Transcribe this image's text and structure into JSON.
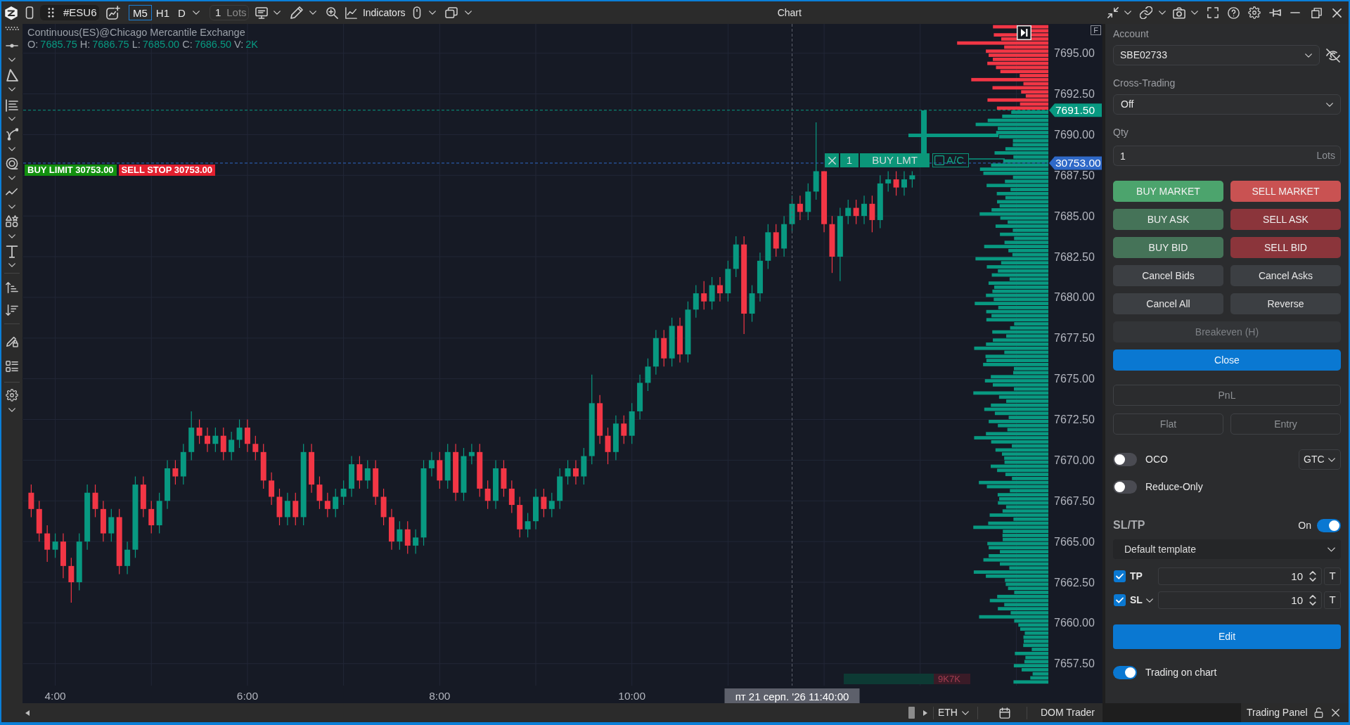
{
  "window": {
    "title": "Chart"
  },
  "toolbar": {
    "symbol": "#ESU6",
    "timeframes": [
      {
        "label": "M5",
        "selected": true
      },
      {
        "label": "H1",
        "selected": false
      },
      {
        "label": "D",
        "selected": false
      }
    ],
    "quantity": {
      "value": "1",
      "unit": "Lots"
    },
    "indicators": "Indicators"
  },
  "chart": {
    "legend": {
      "title": "Continuous(ES)@Chicago Mercantile Exchange",
      "values": [
        {
          "key": "O:",
          "value": "7685.75"
        },
        {
          "key": "H:",
          "value": "7686.75"
        },
        {
          "key": "L:",
          "value": "7685.00"
        },
        {
          "key": "C:",
          "value": "7686.50"
        },
        {
          "key": "V:",
          "value": "2K"
        }
      ]
    },
    "chart_data": [
      {
        "type": "candlestick",
        "x": [
          "2026-08-21T03:45",
          "2026-08-21T03:50",
          "2026-08-21T03:55",
          "2026-08-21T04:00",
          "2026-08-21T04:05",
          "2026-08-21T04:10",
          "2026-08-21T04:15",
          "2026-08-21T04:20",
          "2026-08-21T04:25",
          "2026-08-21T04:30",
          "2026-08-21T04:35",
          "2026-08-21T04:40",
          "2026-08-21T04:45",
          "2026-08-21T04:50",
          "2026-08-21T04:55",
          "2026-08-21T05:00",
          "2026-08-21T05:05",
          "2026-08-21T05:10",
          "2026-08-21T05:15",
          "2026-08-21T05:20",
          "2026-08-21T05:25",
          "2026-08-21T05:30",
          "2026-08-21T05:35",
          "2026-08-21T05:40",
          "2026-08-21T05:45",
          "2026-08-21T05:50",
          "2026-08-21T05:55",
          "2026-08-21T06:00",
          "2026-08-21T06:05",
          "2026-08-21T06:10",
          "2026-08-21T06:15",
          "2026-08-21T06:20",
          "2026-08-21T06:25",
          "2026-08-21T06:30",
          "2026-08-21T06:35",
          "2026-08-21T06:40",
          "2026-08-21T06:45",
          "2026-08-21T06:50",
          "2026-08-21T06:55",
          "2026-08-21T07:00",
          "2026-08-21T07:05",
          "2026-08-21T07:10",
          "2026-08-21T07:15",
          "2026-08-21T07:20",
          "2026-08-21T07:25",
          "2026-08-21T07:30",
          "2026-08-21T07:35",
          "2026-08-21T07:40",
          "2026-08-21T07:45",
          "2026-08-21T07:50",
          "2026-08-21T07:55",
          "2026-08-21T08:00",
          "2026-08-21T08:05",
          "2026-08-21T08:10",
          "2026-08-21T08:15",
          "2026-08-21T08:20",
          "2026-08-21T08:25",
          "2026-08-21T08:30",
          "2026-08-21T08:35",
          "2026-08-21T08:40",
          "2026-08-21T08:45",
          "2026-08-21T08:50",
          "2026-08-21T08:55",
          "2026-08-21T09:00",
          "2026-08-21T09:05",
          "2026-08-21T09:10",
          "2026-08-21T09:15",
          "2026-08-21T09:20",
          "2026-08-21T09:25",
          "2026-08-21T09:30",
          "2026-08-21T09:35",
          "2026-08-21T09:40",
          "2026-08-21T09:45",
          "2026-08-21T09:50",
          "2026-08-21T09:55",
          "2026-08-21T10:00",
          "2026-08-21T10:05",
          "2026-08-21T10:10",
          "2026-08-21T10:15",
          "2026-08-21T10:20",
          "2026-08-21T10:25",
          "2026-08-21T10:30",
          "2026-08-21T10:35",
          "2026-08-21T10:40",
          "2026-08-21T10:45",
          "2026-08-21T10:50",
          "2026-08-21T10:55",
          "2026-08-21T11:00",
          "2026-08-21T11:05",
          "2026-08-21T11:10",
          "2026-08-21T11:15",
          "2026-08-21T11:20",
          "2026-08-21T11:25",
          "2026-08-21T11:30",
          "2026-08-21T11:35",
          "2026-08-21T11:40",
          "2026-08-21T11:45",
          "2026-08-21T11:50",
          "2026-08-21T11:55",
          "2026-08-21T12:00",
          "2026-08-21T12:05",
          "2026-08-21T12:10",
          "2026-08-21T12:15",
          "2026-08-21T12:20",
          "2026-08-21T12:25",
          "2026-08-21T12:30",
          "2026-08-21T12:35",
          "2026-08-21T12:40",
          "2026-08-21T12:45",
          "2026-08-21T12:50",
          "2026-08-21T12:55"
        ],
        "ohlc": [
          [
            7668,
            7668.5,
            7666.5,
            7667
          ],
          [
            7667,
            7667.5,
            7665,
            7665.5
          ],
          [
            7665.5,
            7666,
            7663.75,
            7664.5
          ],
          [
            7664.5,
            7665.5,
            7664,
            7665
          ],
          [
            7665,
            7665.5,
            7662.75,
            7663.5
          ],
          [
            7663.5,
            7664,
            7661.25,
            7662.5
          ],
          [
            7662.5,
            7665.5,
            7662,
            7665
          ],
          [
            7665,
            7668.5,
            7664.5,
            7668
          ],
          [
            7668,
            7668.5,
            7666.5,
            7667
          ],
          [
            7667,
            7667.5,
            7665,
            7665.5
          ],
          [
            7665.5,
            7667,
            7665,
            7666.5
          ],
          [
            7666.5,
            7667,
            7663,
            7663.5
          ],
          [
            7663.5,
            7665,
            7663,
            7664.5
          ],
          [
            7664.5,
            7669,
            7664,
            7668.5
          ],
          [
            7668.5,
            7669,
            7666.5,
            7667
          ],
          [
            7667,
            7667.5,
            7665.5,
            7666
          ],
          [
            7666,
            7668,
            7665.5,
            7667.5
          ],
          [
            7667.5,
            7670,
            7667,
            7669.5
          ],
          [
            7669.5,
            7670,
            7668.5,
            7669
          ],
          [
            7669,
            7671,
            7668.5,
            7670.5
          ],
          [
            7670.5,
            7673,
            7670,
            7672
          ],
          [
            7672,
            7672.5,
            7671,
            7671.5
          ],
          [
            7671.5,
            7672,
            7670.5,
            7671
          ],
          [
            7671,
            7672,
            7670.5,
            7671.5
          ],
          [
            7671.5,
            7672,
            7670,
            7670.5
          ],
          [
            7670.5,
            7671.75,
            7670,
            7671.25
          ],
          [
            7671.25,
            7672.5,
            7670.75,
            7672
          ],
          [
            7672,
            7672.5,
            7670.5,
            7671
          ],
          [
            7671,
            7671.5,
            7670,
            7670.5
          ],
          [
            7670.5,
            7671,
            7668.25,
            7668.75
          ],
          [
            7668.75,
            7669.25,
            7667.25,
            7667.75
          ],
          [
            7667.75,
            7668.25,
            7666,
            7666.5
          ],
          [
            7666.5,
            7668,
            7666,
            7667.5
          ],
          [
            7667.5,
            7668,
            7666,
            7666.5
          ],
          [
            7666.5,
            7671,
            7666,
            7670.5
          ],
          [
            7670.5,
            7671,
            7668,
            7668.5
          ],
          [
            7668.5,
            7669,
            7667,
            7667.5
          ],
          [
            7667.5,
            7668,
            7666.5,
            7667
          ],
          [
            7667,
            7668.25,
            7666.5,
            7667.75
          ],
          [
            7667.75,
            7668.75,
            7667.25,
            7668.25
          ],
          [
            7668.25,
            7670.25,
            7667.75,
            7669.75
          ],
          [
            7669.75,
            7670.25,
            7668.25,
            7668.75
          ],
          [
            7668.75,
            7670,
            7668.25,
            7669.5
          ],
          [
            7669.5,
            7670,
            7667.25,
            7667.75
          ],
          [
            7667.75,
            7668.25,
            7666,
            7666.5
          ],
          [
            7666.5,
            7667,
            7664.5,
            7665
          ],
          [
            7665,
            7666.25,
            7664.5,
            7665.75
          ],
          [
            7665.75,
            7666.25,
            7664.25,
            7664.75
          ],
          [
            7664.75,
            7665.75,
            7664.25,
            7665.25
          ],
          [
            7665.25,
            7670,
            7664.75,
            7669.5
          ],
          [
            7669.5,
            7670.5,
            7669,
            7670
          ],
          [
            7670,
            7670.5,
            7668.25,
            7668.75
          ],
          [
            7668.75,
            7671,
            7668.25,
            7670.5
          ],
          [
            7670.5,
            7671,
            7667.5,
            7668
          ],
          [
            7668,
            7670.75,
            7667.5,
            7670.25
          ],
          [
            7670.25,
            7671,
            7669.75,
            7670.5
          ],
          [
            7670.5,
            7671,
            7667.75,
            7668.25
          ],
          [
            7668.25,
            7668.75,
            7667,
            7667.5
          ],
          [
            7667.5,
            7670,
            7667,
            7669.5
          ],
          [
            7669.5,
            7670,
            7667.75,
            7668.25
          ],
          [
            7668.25,
            7668.75,
            7666.75,
            7667.25
          ],
          [
            7667.25,
            7667.75,
            7665.25,
            7665.75
          ],
          [
            7665.75,
            7666.75,
            7665.25,
            7666.25
          ],
          [
            7666.25,
            7668.25,
            7665.75,
            7667.75
          ],
          [
            7667.75,
            7668.25,
            7666.5,
            7667
          ],
          [
            7667,
            7668,
            7666.5,
            7667.5
          ],
          [
            7667.5,
            7669.5,
            7667,
            7669
          ],
          [
            7669,
            7670,
            7668.5,
            7669.5
          ],
          [
            7669.5,
            7670,
            7668.5,
            7669
          ],
          [
            7669,
            7670.75,
            7668.5,
            7670.25
          ],
          [
            7670.25,
            7675.25,
            7669.75,
            7673.5
          ],
          [
            7673.5,
            7674,
            7671,
            7671.5
          ],
          [
            7671.5,
            7672,
            7669.75,
            7670.5
          ],
          [
            7670.5,
            7672.75,
            7670,
            7672.25
          ],
          [
            7672.25,
            7672.75,
            7671,
            7671.5
          ],
          [
            7671.5,
            7673.5,
            7671,
            7673
          ],
          [
            7673,
            7675.25,
            7672.5,
            7674.75
          ],
          [
            7674.75,
            7676.25,
            7674.25,
            7675.75
          ],
          [
            7675.75,
            7678,
            7675.25,
            7677.5
          ],
          [
            7677.5,
            7678,
            7675.75,
            7676.25
          ],
          [
            7676.25,
            7678.75,
            7675.75,
            7678.25
          ],
          [
            7678.25,
            7678.75,
            7676,
            7676.5
          ],
          [
            7676.5,
            7679.75,
            7676,
            7679.25
          ],
          [
            7679.25,
            7680.75,
            7678.75,
            7680.25
          ],
          [
            7680.25,
            7681,
            7679.25,
            7679.75
          ],
          [
            7679.75,
            7681.25,
            7679.25,
            7680.75
          ],
          [
            7680.75,
            7681.25,
            7679.75,
            7680.25
          ],
          [
            7680.25,
            7682.25,
            7679.75,
            7681.75
          ],
          [
            7681.75,
            7683.75,
            7681.25,
            7683.25
          ],
          [
            7683.25,
            7683.75,
            7677.75,
            7679
          ],
          [
            7679,
            7680.75,
            7678.5,
            7680.25
          ],
          [
            7680.25,
            7682.75,
            7679.75,
            7682.25
          ],
          [
            7682.25,
            7684.5,
            7681.75,
            7684
          ],
          [
            7684,
            7684.5,
            7682.5,
            7683
          ],
          [
            7683,
            7685,
            7682.5,
            7684.5
          ],
          [
            7684.5,
            7686.25,
            7684,
            7685.75
          ],
          [
            7685.75,
            7686.25,
            7684.75,
            7685.25
          ],
          [
            7685.25,
            7687,
            7684.75,
            7686.5
          ],
          [
            7686.5,
            7690.75,
            7686,
            7687.75
          ],
          [
            7687.75,
            7687.75,
            7684,
            7684.5
          ],
          [
            7684.5,
            7685,
            7681.5,
            7682.5
          ],
          [
            7682.5,
            7685.5,
            7681,
            7685
          ],
          [
            7685,
            7686,
            7684.5,
            7685.5
          ],
          [
            7685.5,
            7686,
            7684.5,
            7685
          ],
          [
            7685,
            7686.25,
            7684.5,
            7685.75
          ],
          [
            7685.75,
            7686.25,
            7684,
            7684.75
          ],
          [
            7684.75,
            7687.5,
            7684.25,
            7687
          ],
          [
            7687,
            7687.75,
            7686.5,
            7687.25
          ],
          [
            7687.25,
            7687.75,
            7686.25,
            7686.75
          ],
          [
            7686.75,
            7687.75,
            7686.25,
            7687.25
          ],
          [
            7687.25,
            7687.75,
            7686.75,
            7687.5
          ]
        ],
        "xlim": [
          "2026-08-21T03:40",
          "2026-08-21T14:20"
        ],
        "ylim": [
          7656.15,
          7696.8
        ],
        "xticks": [
          {
            "value": "2026-08-21T04:00",
            "label": "4:00"
          },
          {
            "value": "2026-08-21T06:00",
            "label": "6:00"
          },
          {
            "value": "2026-08-21T08:00",
            "label": "8:00"
          },
          {
            "value": "2026-08-21T10:00",
            "label": "10:00"
          }
        ],
        "yticks": [
          {
            "value": 7695,
            "label": "7695.00"
          },
          {
            "value": 7692.5,
            "label": "7692.50"
          },
          {
            "value": 7690,
            "label": "7690.00"
          },
          {
            "value": 7687.5,
            "label": "7687.50"
          },
          {
            "value": 7685,
            "label": "7685.00"
          },
          {
            "value": 7682.5,
            "label": "7682.50"
          },
          {
            "value": 7680,
            "label": "7680.00"
          },
          {
            "value": 7677.5,
            "label": "7677.50"
          },
          {
            "value": 7675,
            "label": "7675.00"
          },
          {
            "value": 7672.5,
            "label": "7672.50"
          },
          {
            "value": 7670,
            "label": "7670.00"
          },
          {
            "value": 7667.5,
            "label": "7667.50"
          },
          {
            "value": 7665,
            "label": "7665.00"
          },
          {
            "value": 7662.5,
            "label": "7662.50"
          },
          {
            "value": 7660,
            "label": "7660.00"
          },
          {
            "value": 7657.5,
            "label": "7657.50"
          }
        ],
        "ref_lines": [
          {
            "axis": "y",
            "value": 7691.5,
            "label": "7691.50",
            "color": "#089981",
            "line_style": "dashed"
          },
          {
            "axis": "y",
            "value": 7688.25,
            "color": "#2f69c8",
            "line_style": "dashed"
          },
          {
            "axis": "x",
            "value": "2026-08-21T11:40",
            "label": "пт 21 серп. '26 11:40:00",
            "color": "#5d606b",
            "line_style": "dashed"
          }
        ],
        "grid": true
      }
    ],
    "order_price_tag": "30753.00",
    "order_tags": [
      {
        "label": "BUY LIMIT 30753.00",
        "kind": "buy"
      },
      {
        "label": "SELL STOP 30753.00",
        "kind": "sell"
      }
    ],
    "order_widget": {
      "quantity": "1",
      "label": "BUY LMT",
      "ac_label": "A/C",
      "ac_checked": false
    },
    "volume_label": "9K7K",
    "scale_button": "F"
  },
  "bottom_bar": {
    "session": "ETH",
    "tab": "DOM Trader"
  },
  "trading_panel": {
    "account": {
      "label": "Account",
      "value": "SBE02733"
    },
    "cross_trading": {
      "label": "Cross-Trading",
      "value": "Off"
    },
    "qty": {
      "label": "Qty",
      "value": "1",
      "unit": "Lots"
    },
    "button_rows": [
      [
        {
          "label": "BUY MARKET",
          "kind": "buy_market",
          "disabled": false
        },
        {
          "label": "SELL MARKET",
          "kind": "sell_market",
          "disabled": false
        }
      ],
      [
        {
          "label": "BUY ASK",
          "kind": "buy",
          "disabled": false
        },
        {
          "label": "SELL ASK",
          "kind": "sell",
          "disabled": false
        }
      ],
      [
        {
          "label": "BUY BID",
          "kind": "buy",
          "disabled": false
        },
        {
          "label": "SELL BID",
          "kind": "sell",
          "disabled": false
        }
      ],
      [
        {
          "label": "Cancel Bids",
          "kind": "neutral",
          "disabled": false
        },
        {
          "label": "Cancel Asks",
          "kind": "neutral",
          "disabled": false
        }
      ],
      [
        {
          "label": "Cancel All",
          "kind": "neutral",
          "disabled": false
        },
        {
          "label": "Reverse",
          "kind": "neutral",
          "disabled": false
        }
      ],
      [
        {
          "label": "Breakeven (H)",
          "kind": "neutral",
          "disabled": true
        }
      ],
      [
        {
          "label": "Close",
          "kind": "primary",
          "disabled": false
        }
      ]
    ],
    "pnl_rows": [
      [
        "PnL"
      ],
      [
        "Flat",
        "Entry"
      ]
    ],
    "options": [
      {
        "label": "OCO",
        "on": false
      },
      {
        "label": "Reduce-Only",
        "on": false
      }
    ],
    "time_in_force": "GTC",
    "sltp": {
      "title": "SL/TP",
      "status": "On",
      "on": true,
      "template": "Default template",
      "rows": [
        {
          "label": "TP",
          "checked": true,
          "menu": false,
          "value": "10",
          "unit": "T"
        },
        {
          "label": "SL",
          "checked": true,
          "menu": true,
          "value": "10",
          "unit": "T"
        }
      ]
    },
    "edit_button": "Edit",
    "trading_on_chart": {
      "label": "Trading on chart",
      "on": true
    },
    "tab": "Trading Panel"
  }
}
